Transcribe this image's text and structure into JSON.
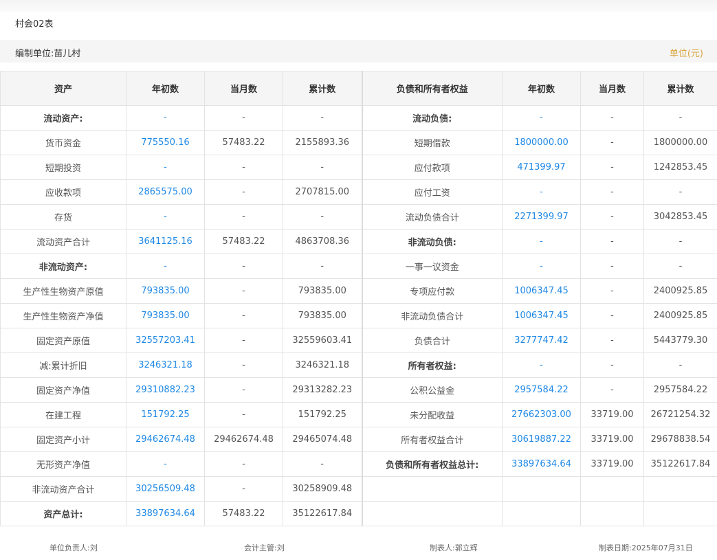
{
  "report": {
    "title": "村会02表"
  },
  "info": {
    "unit_label": "编制单位:苗儿村",
    "unit_note": "单位(元)"
  },
  "headers": [
    "资产",
    "年初数",
    "当月数",
    "累计数",
    "负债和所有者权益",
    "年初数",
    "当月数",
    "累计数"
  ],
  "rows": [
    {
      "left": [
        "流动资产:",
        "-",
        "-",
        "-"
      ],
      "right": [
        "流动负债:",
        "-",
        "-",
        "-"
      ],
      "left_bold": true,
      "right_bold": true
    },
    {
      "left": [
        "货币资金",
        "775550.16",
        "57483.22",
        "2155893.36"
      ],
      "right": [
        "短期借款",
        "1800000.00",
        "-",
        "1800000.00"
      ]
    },
    {
      "left": [
        "短期投资",
        "-",
        "-",
        "-"
      ],
      "right": [
        "应付款项",
        "471399.97",
        "-",
        "1242853.45"
      ]
    },
    {
      "left": [
        "应收款项",
        "2865575.00",
        "-",
        "2707815.00"
      ],
      "right": [
        "应付工资",
        "-",
        "-",
        "-"
      ]
    },
    {
      "left": [
        "存货",
        "-",
        "-",
        "-"
      ],
      "right": [
        "流动负债合计",
        "2271399.97",
        "-",
        "3042853.45"
      ]
    },
    {
      "left": [
        "流动资产合计",
        "3641125.16",
        "57483.22",
        "4863708.36"
      ],
      "right": [
        "非流动负债:",
        "-",
        "-",
        "-"
      ],
      "right_bold": true
    },
    {
      "left": [
        "非流动资产:",
        "-",
        "-",
        "-"
      ],
      "right": [
        "一事一议资金",
        "-",
        "-",
        "-"
      ],
      "left_bold": true
    },
    {
      "left": [
        "生产性生物资产原值",
        "793835.00",
        "-",
        "793835.00"
      ],
      "right": [
        "专项应付款",
        "1006347.45",
        "-",
        "2400925.85"
      ]
    },
    {
      "left": [
        "生产性生物资产净值",
        "793835.00",
        "-",
        "793835.00"
      ],
      "right": [
        "非流动负债合计",
        "1006347.45",
        "-",
        "2400925.85"
      ]
    },
    {
      "left": [
        "固定资产原值",
        "32557203.41",
        "-",
        "32559603.41"
      ],
      "right": [
        "负债合计",
        "3277747.42",
        "-",
        "5443779.30"
      ]
    },
    {
      "left": [
        "减:累计折旧",
        "3246321.18",
        "-",
        "3246321.18"
      ],
      "right": [
        "所有者权益:",
        "-",
        "-",
        "-"
      ],
      "right_bold": true
    },
    {
      "left": [
        "固定资产净值",
        "29310882.23",
        "-",
        "29313282.23"
      ],
      "right": [
        "公积公益金",
        "2957584.22",
        "-",
        "2957584.22"
      ]
    },
    {
      "left": [
        "在建工程",
        "151792.25",
        "-",
        "151792.25"
      ],
      "right": [
        "未分配收益",
        "27662303.00",
        "33719.00",
        "26721254.32"
      ]
    },
    {
      "left": [
        "固定资产小计",
        "29462674.48",
        "29462674.48",
        "29465074.48"
      ],
      "right": [
        "所有者权益合计",
        "30619887.22",
        "33719.00",
        "29678838.54"
      ]
    },
    {
      "left": [
        "无形资产净值",
        "-",
        "-",
        "-"
      ],
      "right": [
        "负债和所有者权益总计:",
        "33897634.64",
        "33719.00",
        "35122617.84"
      ],
      "right_bold": true
    },
    {
      "left": [
        "非流动资产合计",
        "30256509.48",
        "-",
        "30258909.48"
      ],
      "right": [
        "",
        "",
        "",
        ""
      ]
    },
    {
      "left": [
        "资产总计:",
        "33897634.64",
        "57483.22",
        "35122617.84"
      ],
      "right": [
        "",
        "",
        "",
        ""
      ],
      "left_bold": true
    }
  ],
  "footer": {
    "unit_head": "单位负责人:刘",
    "accountant": "会计主管:刘",
    "preparer": "制表人:郭立辉",
    "date": "制表日期:2025年07月31日"
  }
}
